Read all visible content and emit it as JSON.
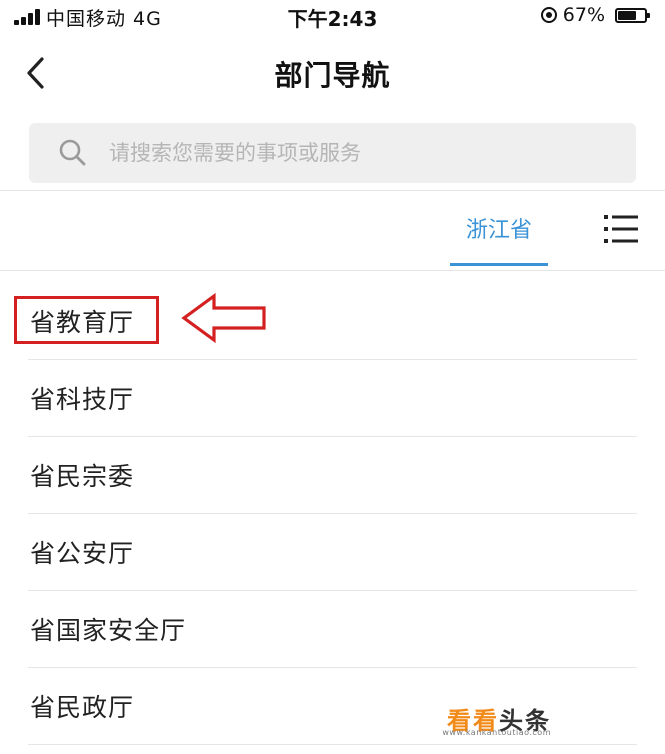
{
  "status_bar": {
    "carrier": "中国移动  4G",
    "time": "下午2:43",
    "battery_percent": "67%",
    "icons": [
      "signal-icon",
      "orientation-lock-icon",
      "battery-icon"
    ]
  },
  "nav": {
    "title": "部门导航",
    "back_icon": "chevron-left-icon"
  },
  "search": {
    "placeholder": "请搜索您需要的事项或服务",
    "value": "",
    "icon": "search-icon"
  },
  "region_tabs": {
    "selected": "浙江省",
    "menu_icon": "list-menu-icon"
  },
  "departments": [
    {
      "label": "省教育厅"
    },
    {
      "label": "省科技厅"
    },
    {
      "label": "省民宗委"
    },
    {
      "label": "省公安厅"
    },
    {
      "label": "省国家安全厅"
    },
    {
      "label": "省民政厅"
    }
  ],
  "annotation": {
    "highlight_color": "#d42020",
    "highlighted_item": "省教育厅"
  },
  "watermark": {
    "brand_accent": "看看",
    "brand_rest": "头条",
    "url": "www.kankantoutiao.com"
  },
  "colors": {
    "accent": "#3a93d6",
    "search_bg": "#efefef",
    "divider": "#e6e6e6",
    "watermark": "#f28a1a"
  }
}
